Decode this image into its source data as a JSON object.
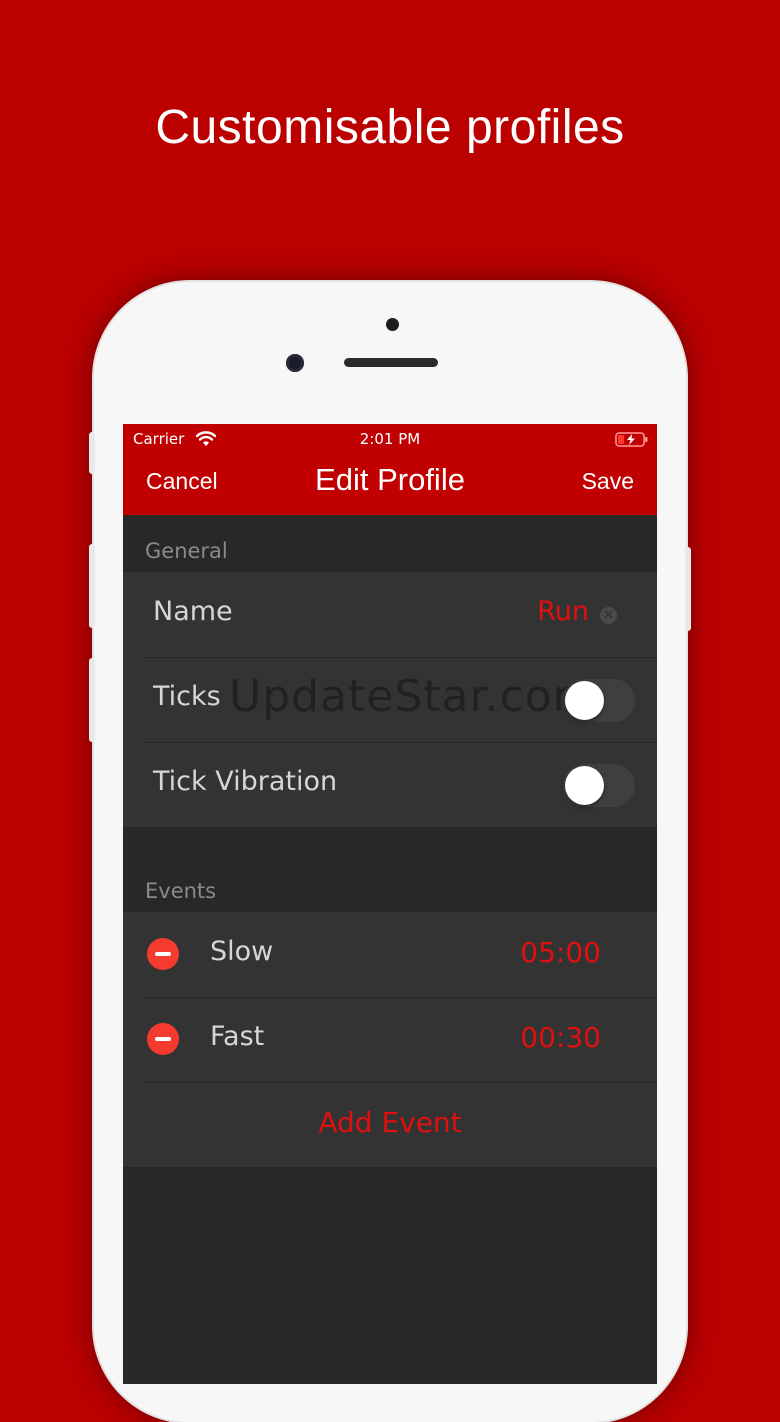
{
  "headline": "Customisable profiles",
  "status_bar": {
    "carrier": "Carrier",
    "time": "2:01 PM"
  },
  "nav": {
    "cancel": "Cancel",
    "title": "Edit Profile",
    "save": "Save"
  },
  "general": {
    "header": "General",
    "name_label": "Name",
    "name_value": "Run",
    "ticks_label": "Ticks",
    "ticks_on": false,
    "tick_vibration_label": "Tick Vibration",
    "tick_vibration_on": false
  },
  "watermark": "UpdateStar.com",
  "events": {
    "header": "Events",
    "items": [
      {
        "label": "Slow",
        "time": "05:00"
      },
      {
        "label": "Fast",
        "time": "00:30"
      }
    ],
    "add_label": "Add Event"
  },
  "colors": {
    "brand_red": "#bb0000",
    "accent_red": "#e01010",
    "delete_red": "#f53b30"
  }
}
